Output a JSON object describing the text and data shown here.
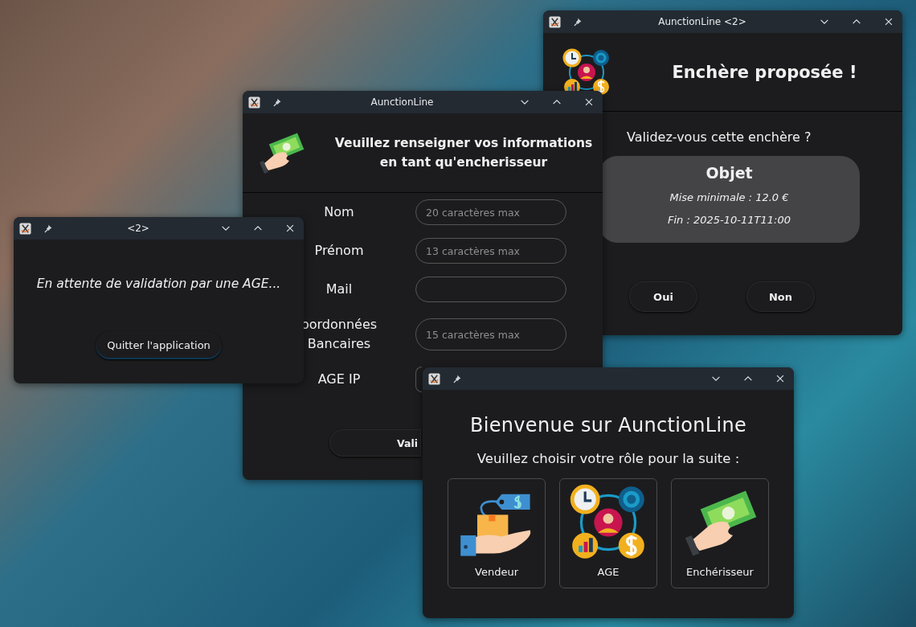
{
  "windows": [
    {
      "kind": "confirm",
      "title": "AunctionLine <2>",
      "heading": "Enchère proposée !",
      "question": "Validez-vous cette enchère ?",
      "item": {
        "title": "Objet",
        "min_bid": "Mise minimale : 12.0 €",
        "end": "Fin : 2025-10-11T11:00"
      },
      "buttons": [
        "Oui",
        "Non"
      ]
    },
    {
      "kind": "form",
      "title": "AunctionLine",
      "heading": "Veuillez renseigner vos informations en tant qu'encherisseur",
      "fields": [
        {
          "label": "Nom",
          "placeholder": "20 caractères max"
        },
        {
          "label": "Prénom",
          "placeholder": "13 caractères max"
        },
        {
          "label": "Mail"
        },
        {
          "label": "oordonnées Bancaires",
          "placeholder": "15 caractères max"
        },
        {
          "label": "AGE IP"
        }
      ],
      "button": "Vali"
    },
    {
      "kind": "waiting",
      "title": "<2>",
      "message": "En attente de validation par une AGE...",
      "button": "Quitter l'application"
    },
    {
      "kind": "welcome",
      "heading": "Bienvenue sur AunctionLine",
      "prompt": "Veuillez choisir votre rôle pour la suite :",
      "roles": [
        {
          "kind": "seller",
          "label": "Vendeur"
        },
        {
          "kind": "agency",
          "label": "AGE"
        },
        {
          "kind": "bidder",
          "label": "Enchérisseur"
        }
      ]
    }
  ]
}
